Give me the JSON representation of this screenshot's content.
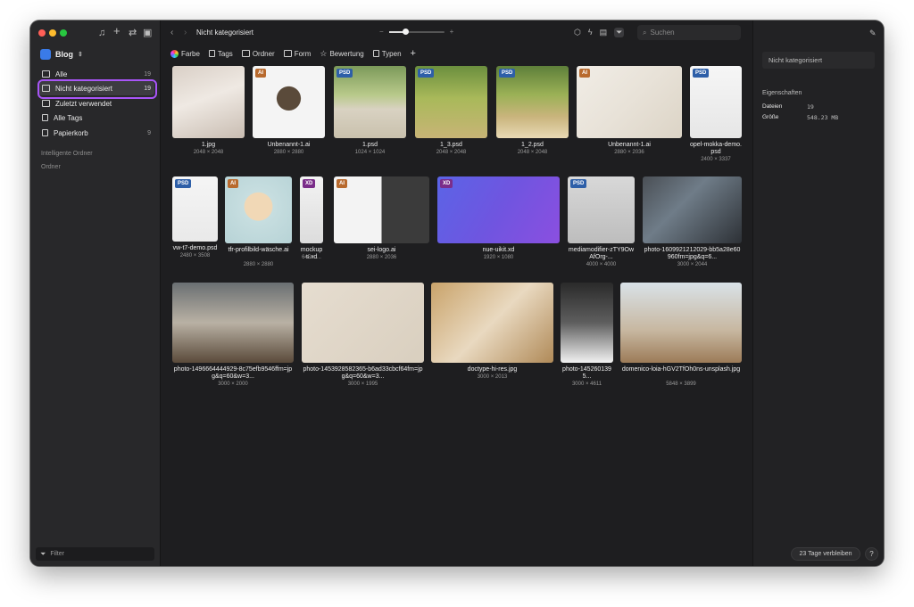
{
  "sidebar": {
    "library": "Blog",
    "items": [
      {
        "label": "Alle",
        "count": "19"
      },
      {
        "label": "Nicht kategorisiert",
        "count": "19"
      },
      {
        "label": "Zuletzt verwendet",
        "count": ""
      },
      {
        "label": "Alle Tags",
        "count": ""
      },
      {
        "label": "Papierkorb",
        "count": "9"
      }
    ],
    "sections": [
      "Intelligente Ordner",
      "Ordner"
    ],
    "filter_placeholder": "Filter"
  },
  "toolbar": {
    "breadcrumb": "Nicht kategorisiert",
    "zoom_minus": "−",
    "zoom_plus": "+",
    "zoom_level": 0.3,
    "search_placeholder": "Suchen"
  },
  "filterbar": [
    "Farbe",
    "Tags",
    "Ordner",
    "Form",
    "Bewertung",
    "Typen"
  ],
  "files": [
    {
      "name": "1.jpg",
      "dims": "2048 × 2048",
      "badge": ""
    },
    {
      "name": "Unbenannt-1.ai",
      "dims": "2880 × 2880",
      "badge": "AI"
    },
    {
      "name": "1.psd",
      "dims": "1024 × 1024",
      "badge": "PSD"
    },
    {
      "name": "1_3.psd",
      "dims": "2048 × 2048",
      "badge": "PSD"
    },
    {
      "name": "1_2.psd",
      "dims": "2048 × 2048",
      "badge": "PSD"
    },
    {
      "name": "Unbenannt-1.ai",
      "dims": "2880 × 2036",
      "badge": "AI"
    },
    {
      "name": "opel-mokka-demo.psd",
      "dims": "2400 × 3337",
      "badge": "PSD"
    },
    {
      "name": "vw-t7-demo.psd",
      "dims": "2480 × 3508",
      "badge": "PSD"
    },
    {
      "name": "tfr-profilbild-wäsche.ai",
      "dims": "2880 × 2880",
      "badge": "AI"
    },
    {
      "name": "mockups.xd",
      "dims": "645 × ...",
      "badge": "XD"
    },
    {
      "name": "sei-logo.ai",
      "dims": "2880 × 2036",
      "badge": "AI"
    },
    {
      "name": "nue-uikit.xd",
      "dims": "1920 × 1080",
      "badge": "XD"
    },
    {
      "name": "mediamodifier-zTY9OwAfOrg-...",
      "dims": "4000 × 4000",
      "badge": "PSD"
    },
    {
      "name": "photo-1609921212029-bb5a28e60960fm=jpg&q=6...",
      "dims": "3000 × 2044",
      "badge": ""
    },
    {
      "name": "photo-1496664444929-8c75efb9546ffm=jpg&q=60&w=3...",
      "dims": "3000 × 2000",
      "badge": ""
    },
    {
      "name": "photo-1453928582365-b6ad33cbcf64fm=jpg&q=60&w=3...",
      "dims": "3000 × 1995",
      "badge": ""
    },
    {
      "name": "doctype-hi-res.jpg",
      "dims": "3000 × 2013",
      "badge": ""
    },
    {
      "name": "photo-1452601395...",
      "dims": "3000 × 4611",
      "badge": ""
    },
    {
      "name": "domenico-loia-hGV2TfOh0ns-unsplash.jpg",
      "dims": "5848 × 3899",
      "badge": ""
    }
  ],
  "inspector": {
    "name_field": "Nicht kategorisiert",
    "heading": "Eigenschaften",
    "props": [
      {
        "label": "Dateien",
        "value": "19"
      },
      {
        "label": "Größe",
        "value": "548.23 MB"
      }
    ],
    "trial": "23 Tage verbleiben",
    "help": "?"
  },
  "colors": {
    "selection_ring": "#a855f7",
    "library_icon": "#3a7be8",
    "badge_psd": "#2e5fa8",
    "badge_ai": "#b86a2e",
    "badge_xd": "#7b2d8a"
  }
}
